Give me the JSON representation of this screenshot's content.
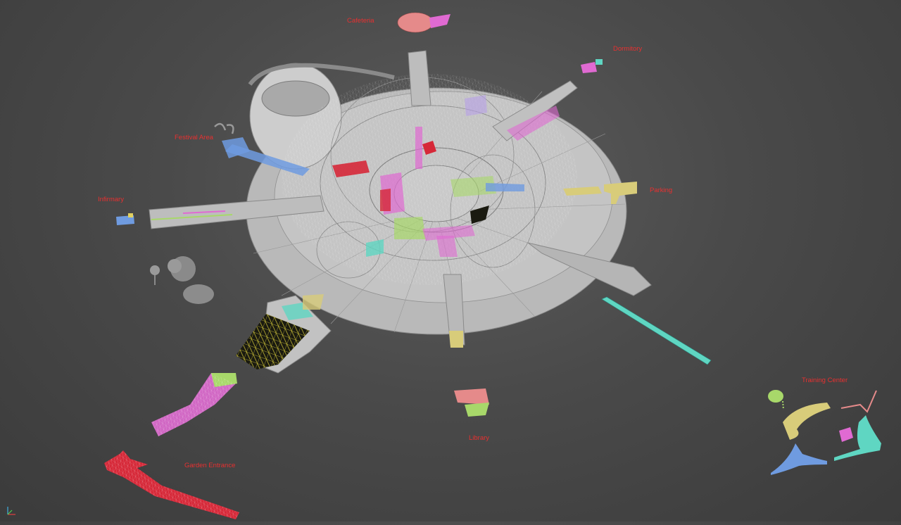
{
  "viewport": {
    "label_color": "#e83030",
    "wire_color": "#cfcfcf",
    "solid_color": "#bdbdbd"
  },
  "labels": {
    "cafeteria": "Cafeteria",
    "dormitory": "Dormitory",
    "festival_area": "Festival Area",
    "infirmary": "Infirmary",
    "parking": "Parking",
    "library": "Library",
    "training_center": "Training Center",
    "garden_entrance": "Garden Entrance"
  },
  "zone_colors": {
    "pink": "#e06ad2",
    "blue": "#6f9be0",
    "yellow": "#d8cc7a",
    "cyan": "#5fd6c2",
    "red": "#d62838",
    "green": "#a8d86a",
    "salmon": "#e58a8a",
    "black_mesh": "#1a1a10"
  },
  "icons": {
    "axis_gizmo": "axis-gizmo-icon"
  }
}
